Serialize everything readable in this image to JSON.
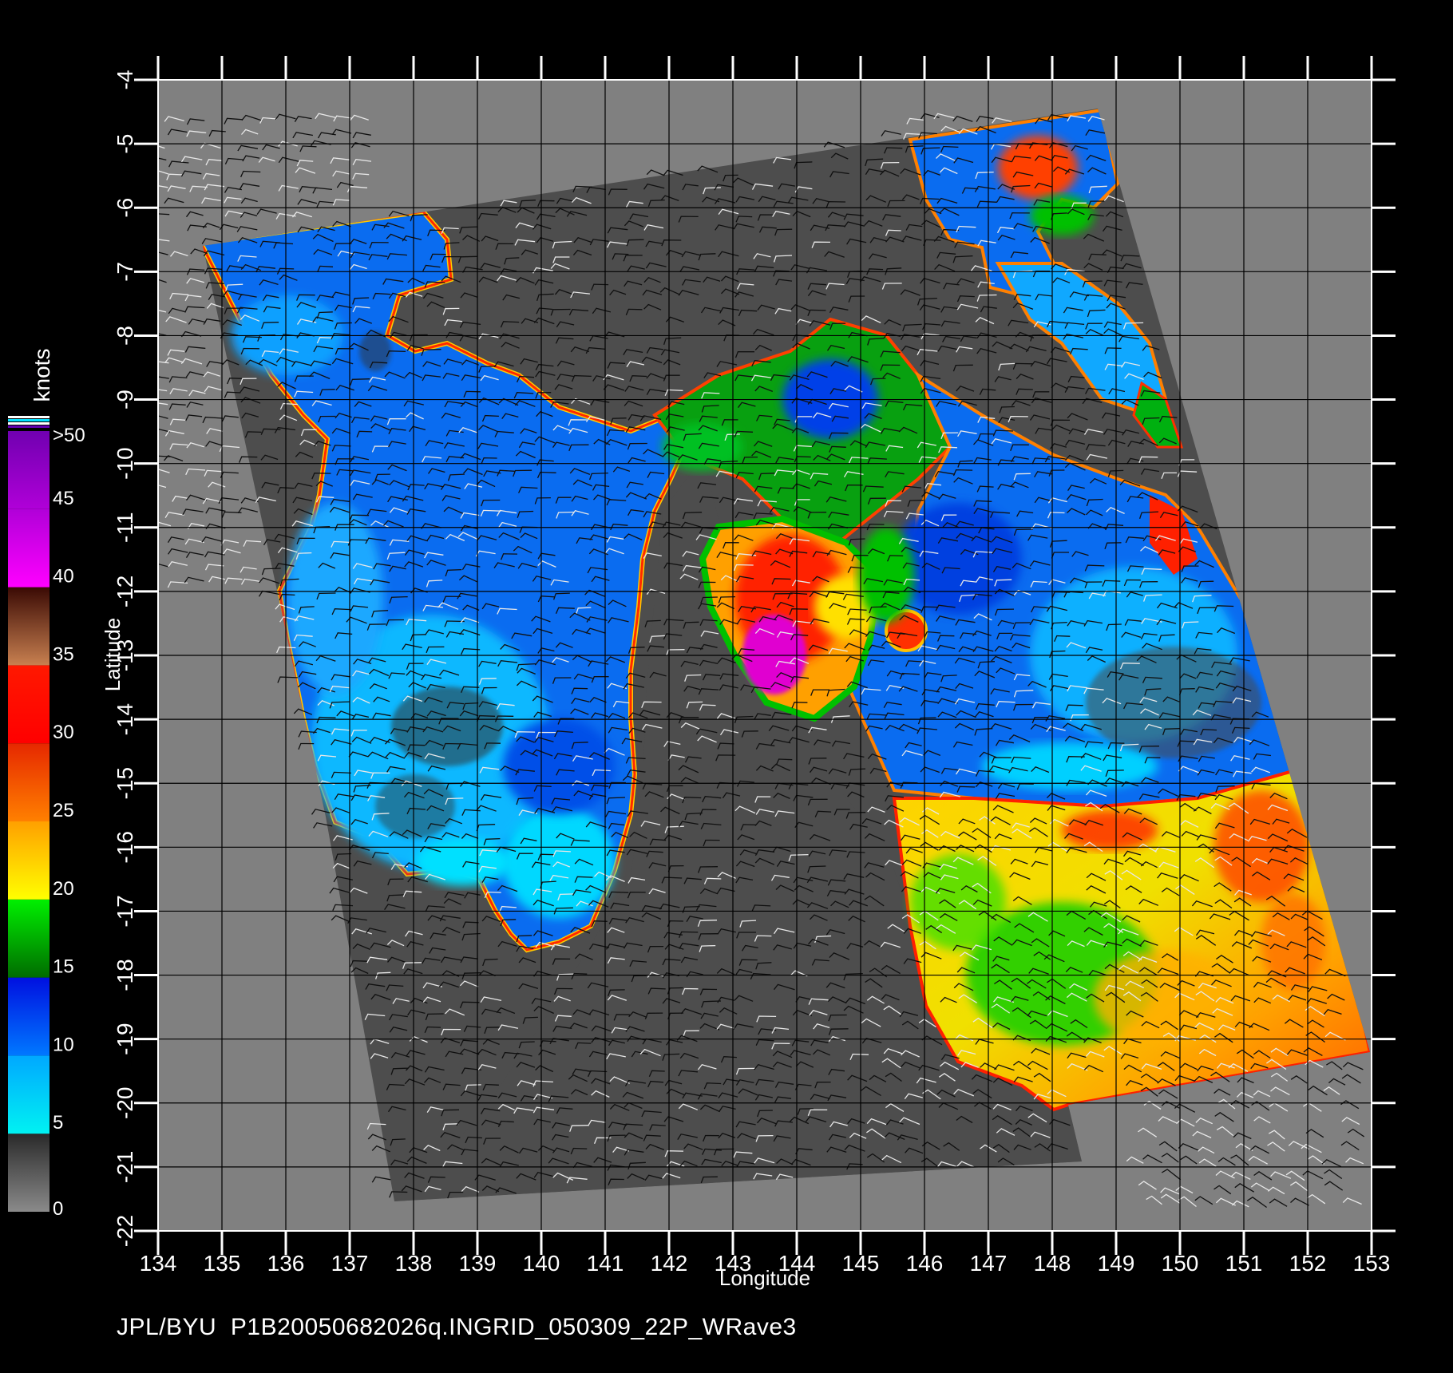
{
  "map": {
    "xlabel": "Longitude",
    "ylabel": "Latitude",
    "lon_ticks": [
      134,
      135,
      136,
      137,
      138,
      139,
      140,
      141,
      142,
      143,
      144,
      145,
      146,
      147,
      148,
      149,
      150,
      151,
      152,
      153
    ],
    "lat_ticks": [
      -4,
      -5,
      -6,
      -7,
      -8,
      -9,
      -10,
      -11,
      -12,
      -13,
      -14,
      -15,
      -16,
      -17,
      -18,
      -19,
      -20,
      -21,
      -22
    ],
    "lon_range": [
      134,
      153
    ],
    "lat_range": [
      -22,
      -4
    ],
    "grid": true,
    "background": "#808080",
    "swath_fill": "#4d4d4d"
  },
  "colorbar": {
    "title": "knots",
    "labels": [
      ">50",
      "45",
      "40",
      "35",
      "30",
      "25",
      "20",
      "15",
      "10",
      "5",
      "0"
    ],
    "bands": [
      {
        "from": 0,
        "to": 5,
        "colors": [
          "#8a8a8a",
          "#2a2a2a"
        ]
      },
      {
        "from": 5,
        "to": 10,
        "colors": [
          "#00f2f2",
          "#00a8ff"
        ]
      },
      {
        "from": 10,
        "to": 15,
        "colors": [
          "#0078ff",
          "#0010e0"
        ]
      },
      {
        "from": 15,
        "to": 20,
        "colors": [
          "#006c00",
          "#00f000"
        ]
      },
      {
        "from": 20,
        "to": 25,
        "colors": [
          "#ffff00",
          "#ffa000"
        ]
      },
      {
        "from": 25,
        "to": 30,
        "colors": [
          "#ff8000",
          "#e62800"
        ]
      },
      {
        "from": 30,
        "to": 35,
        "colors": [
          "#ff0000",
          "#ff1800"
        ]
      },
      {
        "from": 35,
        "to": 40,
        "colors": [
          "#c88050",
          "#3a0a04"
        ]
      },
      {
        "from": 40,
        "to": 45,
        "colors": [
          "#ff00ff",
          "#b000d8"
        ]
      },
      {
        "from": 45,
        "to": 50,
        "colors": [
          "#b000d8",
          "#7000b0"
        ]
      }
    ]
  },
  "footer": "JPL/BYU  P1B20050682026q.INGRID_050309_22P_WRave3"
}
